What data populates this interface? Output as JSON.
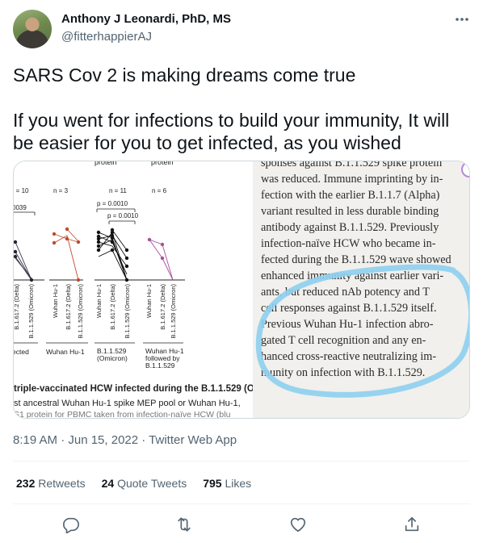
{
  "author": {
    "name": "Anthony J Leonardi, PhD, MS",
    "handle": "@fitterhappierAJ"
  },
  "tweet": {
    "line1": "SARS Cov 2 is making dreams come true",
    "line2": "If you went for infections to build your immunity, It will be easier for you to get infected, as you wished"
  },
  "media": {
    "figure": {
      "top_labels": [
        "protein",
        "protein"
      ],
      "n_labels": [
        "n = 10",
        "n = 3",
        "n = 11",
        "n = 6"
      ],
      "p_values": [
        "p = 0.0010",
        "p = 0.0010"
      ],
      "partial_tick": "0039",
      "bottom_group_labels": [
        "ected",
        "Wuhan Hu-1",
        "B.1.1.529\n(Omicron)",
        "Wuhan Hu-1\nfollowed by\nB.1.1.529"
      ],
      "x_tick_labels": [
        "B.1.617.2 (Delta)",
        "B.1.1.529 (Omicron)",
        "Wuhan Hu-1",
        "B.1.617.2 (Delta)",
        "B.1.1.529 (Omicron)",
        "Wuhan Hu-1",
        "B.1.617.2 (Delta)",
        "B.1.1.529 (Omicron)",
        "Wuhan Hu-1",
        "B.1.617.2 (Delta)",
        "B.1.1.529 (Omicron)"
      ]
    },
    "caption": {
      "line1": "triple-vaccinated HCW infected during the B.1.1.529 (Or",
      "line2": "st ancestral Wuhan Hu-1 spike MEP pool or Wuhan Hu-1,",
      "line3": "S1 protein for PBMC taken from infection-naïve HCW (blu"
    },
    "article_lines": [
      "sponses against B.1.1.529 spike protein",
      "was reduced. Immune imprinting by in-",
      "fection with the earlier B.1.1.7 (Alpha)",
      "variant resulted in less durable binding",
      "antibody against B.1.1.529. Previously",
      "infection-naïve HCW who became in-",
      "fected during the B.1.1.529 wave showed",
      "enhanced immunity against earlier vari-",
      "ants, but reduced nAb potency and T",
      "cell responses against B.1.1.529 itself.",
      "Previous Wuhan Hu-1 infection abro-",
      "gated T cell recognition and any en-",
      "hanced cross-reactive neutralizing im-",
      "munity on infection with B.1.1.529."
    ],
    "highlight_color": "#8fd0ef"
  },
  "meta": {
    "timestamp": "8:19 AM · Jun 15, 2022 · Twitter Web App"
  },
  "stats": {
    "retweets_count": "232",
    "retweets_label": "Retweets",
    "quotes_count": "24",
    "quotes_label": "Quote Tweets",
    "likes_count": "795",
    "likes_label": "Likes"
  },
  "actions": {
    "icons": [
      "reply-icon",
      "retweet-icon",
      "like-icon",
      "share-icon"
    ]
  },
  "colors": {
    "text": "#0f1419",
    "secondary": "#536471",
    "border": "#cfd9de",
    "divider": "#eff3f4"
  }
}
